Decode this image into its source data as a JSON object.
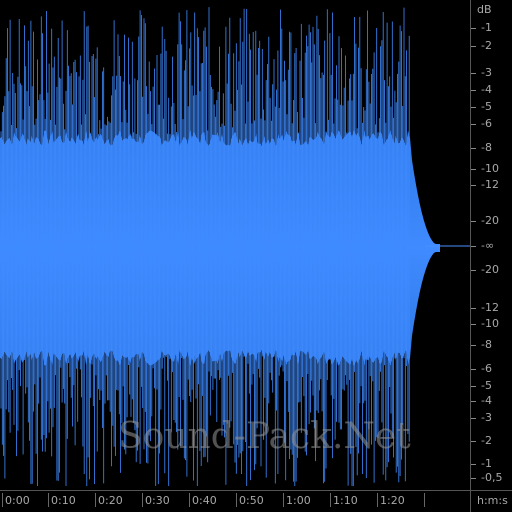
{
  "db_scale": {
    "unit": "dB",
    "labels": [
      "-1",
      "-2",
      "-3",
      "-4",
      "-5",
      "-6",
      "-8",
      "-10",
      "-12",
      "-20",
      "-∞",
      "-20",
      "-12",
      "-10",
      "-8",
      "-6",
      "-5",
      "-4",
      "-3",
      "-2",
      "-1",
      "-0,5"
    ]
  },
  "time_scale": {
    "unit": "h:m:s",
    "labels": [
      "0:00",
      "0:10",
      "0:20",
      "0:30",
      "0:40",
      "0:50",
      "1:00",
      "1:10",
      "1:20"
    ]
  },
  "watermark": "Sound-Pack.Net",
  "colors": {
    "wave_top": "#2e78e6",
    "wave_bottom": "#2e78e6",
    "wave_light": "#3f8bff",
    "background": "#000000",
    "center_line": "#4a90ff"
  }
}
